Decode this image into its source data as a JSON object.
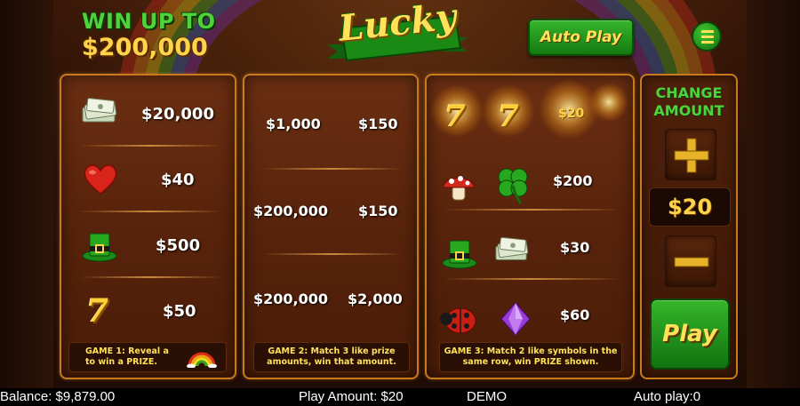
{
  "header": {
    "win_up_to": "WIN UP TO",
    "win_amount": "$200,000",
    "logo_text": "Lucky",
    "autoplay_label": "Auto Play"
  },
  "game1": {
    "rows": [
      {
        "symbol": "money-stack",
        "prize": "$20,000"
      },
      {
        "symbol": "heart",
        "prize": "$40"
      },
      {
        "symbol": "leprechaun-hat",
        "prize": "$500"
      },
      {
        "symbol": "seven",
        "symbol_text": "7",
        "prize": "$50"
      }
    ],
    "instruction_line1": "GAME 1: Reveal a",
    "instruction_line2": "to win a PRIZE."
  },
  "game2": {
    "rows": [
      [
        "$1,000",
        "$150"
      ],
      [
        "$200,000",
        "$150"
      ],
      [
        "$200,000",
        "$2,000"
      ]
    ],
    "instruction_line1": "GAME 2: Match 3 like prize",
    "instruction_line2": "amounts, win that amount."
  },
  "game3": {
    "top_row": [
      "7",
      "7",
      "$20"
    ],
    "rows": [
      {
        "symbols": [
          "mushroom",
          "clover"
        ],
        "prize": "$200"
      },
      {
        "symbols": [
          "leprechaun-hat",
          "money-stack"
        ],
        "prize": "$30"
      },
      {
        "symbols": [
          "ladybug",
          "purple-gem"
        ],
        "prize": "$60"
      }
    ],
    "instruction_line1": "GAME 3: Match 2 like symbols in the",
    "instruction_line2": "same row, win PRIZE shown."
  },
  "side": {
    "change_line1": "CHANGE",
    "change_line2": "AMOUNT",
    "amount": "$20",
    "play_label": "Play"
  },
  "status": {
    "balance": "Balance: $9,879.00",
    "play_amount": "Play Amount: $20",
    "mode": "DEMO",
    "auto_play": "Auto play:0"
  },
  "colors": {
    "accent_green": "#37b52c",
    "gold": "#ffd34a",
    "panel_border": "#c87a1c"
  }
}
